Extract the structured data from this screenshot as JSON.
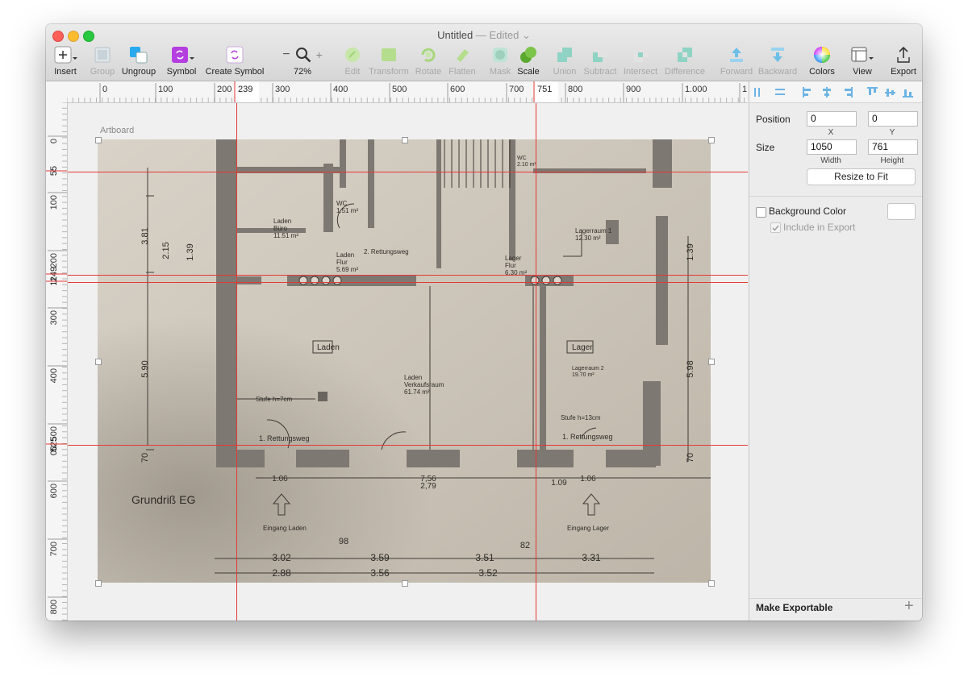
{
  "window": {
    "title": "Untitled",
    "title_suffix": "— Edited",
    "chevron": "⌄"
  },
  "toolbar": {
    "insert": "Insert",
    "group": "Group",
    "ungroup": "Ungroup",
    "symbol": "Symbol",
    "create_symbol": "Create Symbol",
    "zoom": "72%",
    "zoom_minus": "−",
    "zoom_plus": "+",
    "edit": "Edit",
    "transform": "Transform",
    "rotate": "Rotate",
    "flatten": "Flatten",
    "mask": "Mask",
    "scale": "Scale",
    "union": "Union",
    "subtract": "Subtract",
    "intersect": "Intersect",
    "difference": "Difference",
    "forward": "Forward",
    "backward": "Backward",
    "colors": "Colors",
    "view": "View",
    "export": "Export"
  },
  "rulers": {
    "h_ticks": [
      "0",
      "100",
      "200",
      "300",
      "400",
      "500",
      "600",
      "700",
      "800",
      "900",
      "1.000",
      "1."
    ],
    "h_markers": [
      "239",
      "751"
    ],
    "v_ticks": [
      "0",
      "100",
      "200",
      "300",
      "400",
      "500",
      "600",
      "700",
      "800"
    ],
    "v_markers": [
      "55",
      "249",
      "11",
      "525",
      "00"
    ]
  },
  "canvas": {
    "artboard_label": "Artboard",
    "plan_texts": {
      "title": "Grundriß EG",
      "laden_buero": "Laden\nBüro\n11.51 m²",
      "wc1": "WC\n1.51 m²",
      "rettungsweg2": "2. Rettungsweg",
      "laden_flur": "Laden\nFlur\n5.69 m²",
      "lager_flur": "Lager\nFlur\n6.30 m²",
      "lagerraum1": "Lagerraum 1\n12.30 m²",
      "wc2": "WC\n2.10 m²",
      "laden_box": "Laden",
      "lager_box": "Lager",
      "verkauf": "Laden\nVerkaufsraum\n61.74 m²",
      "lagerraum2": "Lagerraum 2\n19.70 m²",
      "stufe7": "Stufe h=7cm",
      "stufe13": "Stufe h=13cm",
      "rettung1a": "1. Rettungsweg",
      "rettung1b": "1. Rettungsweg",
      "eingang_laden": "Eingang Laden",
      "eingang_lager": "Eingang Lager",
      "dim_381": "3.81",
      "dim_215": "2.15",
      "dim_590": "5.90",
      "dim_598": "5.98",
      "dim_139a": "1.39",
      "dim_139b": "1.39",
      "dim_302": "3.02",
      "dim_288": "2.88",
      "dim_359": "3.59",
      "dim_356": "3.56",
      "dim_351": "3.51",
      "dim_352": "3.52",
      "dim_331": "3.31",
      "dim_756": "7,56",
      "dim_279": "2,79",
      "dim_98": "98",
      "dim_82": "82",
      "dim_70a": "70",
      "dim_70b": "70",
      "dim_106a": "1.06",
      "dim_106b": "1.06",
      "dim_109": "1.09"
    }
  },
  "inspector": {
    "position_label": "Position",
    "x_value": "0",
    "y_value": "0",
    "x_caption": "X",
    "y_caption": "Y",
    "size_label": "Size",
    "width_value": "1050",
    "height_value": "761",
    "width_caption": "Width",
    "height_caption": "Height",
    "resize_button": "Resize to Fit",
    "background_color": "Background Color",
    "include_export": "Include in Export",
    "make_exportable": "Make Exportable",
    "plus": "+"
  }
}
